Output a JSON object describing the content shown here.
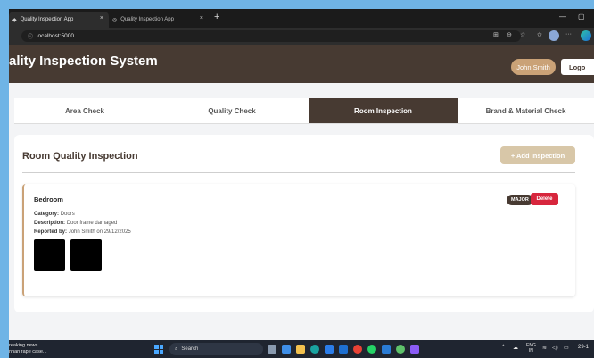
{
  "browser": {
    "tabs": [
      {
        "title": "Quality Inspection App",
        "close": "×"
      },
      {
        "title": "Quality Inspection App",
        "close": "×"
      }
    ],
    "new_tab": "+",
    "address": "localhost:5000"
  },
  "header": {
    "title": "ality Inspection System",
    "user": "John Smith",
    "logout": "Logo"
  },
  "tabs": [
    {
      "label": "Area Check"
    },
    {
      "label": "Quality Check"
    },
    {
      "label": "Room Inspection"
    },
    {
      "label": "Brand & Material Check"
    }
  ],
  "section": {
    "title": "Room Quality Inspection",
    "add_button": "+ Add Inspection"
  },
  "inspection": {
    "room": "Bedroom",
    "severity": "MAJOR",
    "delete": "Delete",
    "category_label": "Category:",
    "category": "Doors",
    "description_label": "Description:",
    "description": "Door frame damaged",
    "reported_label": "Reported by:",
    "reported": "John Smith on 29/12/2025"
  },
  "taskbar": {
    "news_title": "reaking news",
    "news_sub": "nnan rape case...",
    "search": "Search",
    "lang_top": "ENG",
    "lang_bottom": "IN",
    "time": "29-1"
  },
  "colors": {
    "header_bg": "#473a32",
    "accent": "#caa277",
    "danger": "#d7263d"
  }
}
